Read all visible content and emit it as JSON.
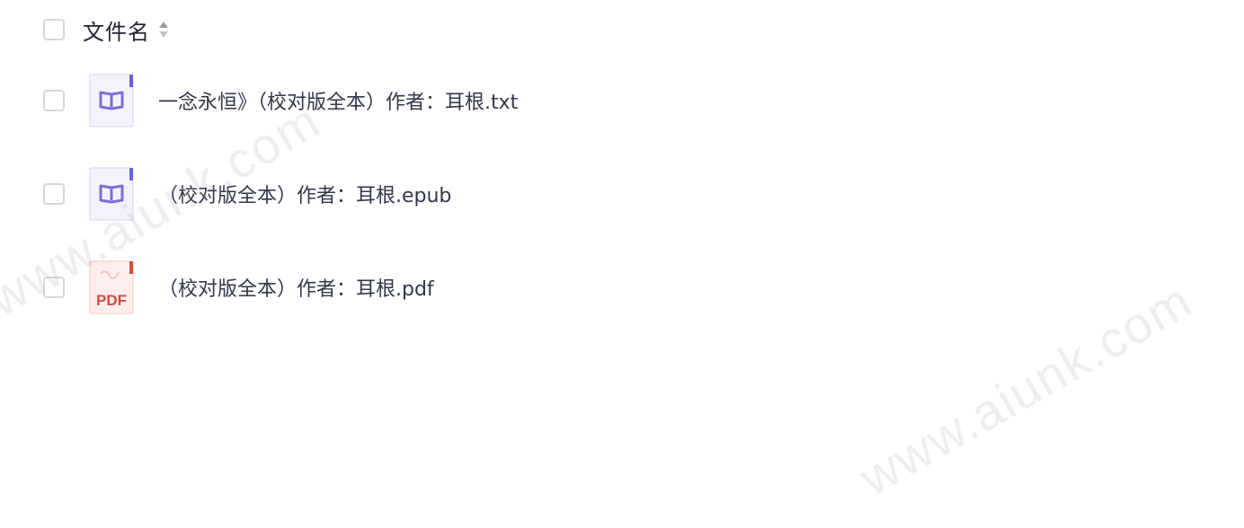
{
  "header": {
    "column_label": "文件名",
    "sort_icon": "sort-icon"
  },
  "files": [
    {
      "name": "一念永恒》（校对版全本）作者：耳根.txt",
      "icon": "book-icon",
      "icon_color": "#7b6fd6"
    },
    {
      "name": "（校对版全本）作者：耳根.epub",
      "icon": "book-icon",
      "icon_color": "#7b6fd6"
    },
    {
      "name": "（校对版全本）作者：耳根.pdf",
      "icon": "pdf-icon",
      "icon_color": "#d84a42",
      "icon_label": "PDF"
    }
  ],
  "watermark": "www.aiunk.com"
}
